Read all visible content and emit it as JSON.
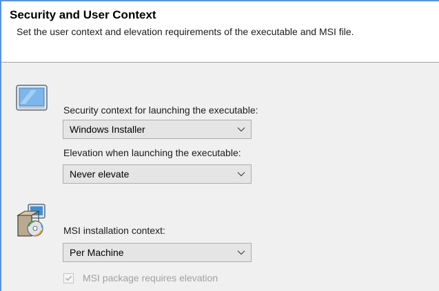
{
  "header": {
    "title": "Security and User Context",
    "subtitle": "Set the user context and elevation requirements of the executable and MSI file."
  },
  "executable": {
    "icon": "window-icon",
    "security_label": "Security context for launching the executable:",
    "security_value": "Windows Installer",
    "elevation_label": "Elevation when launching the executable:",
    "elevation_value": "Never elevate"
  },
  "msi": {
    "icon": "msi-installer-icon",
    "context_label": "MSI installation context:",
    "context_value": "Per Machine",
    "requires_elevation_label": "MSI package requires elevation",
    "requires_elevation_checked": true,
    "requires_elevation_enabled": false
  },
  "colors": {
    "frame_border": "#5b92d9",
    "content_bg": "#f0f0f0",
    "combo_bg": "#e5e5e5",
    "disabled_text": "#a0a0a0"
  }
}
